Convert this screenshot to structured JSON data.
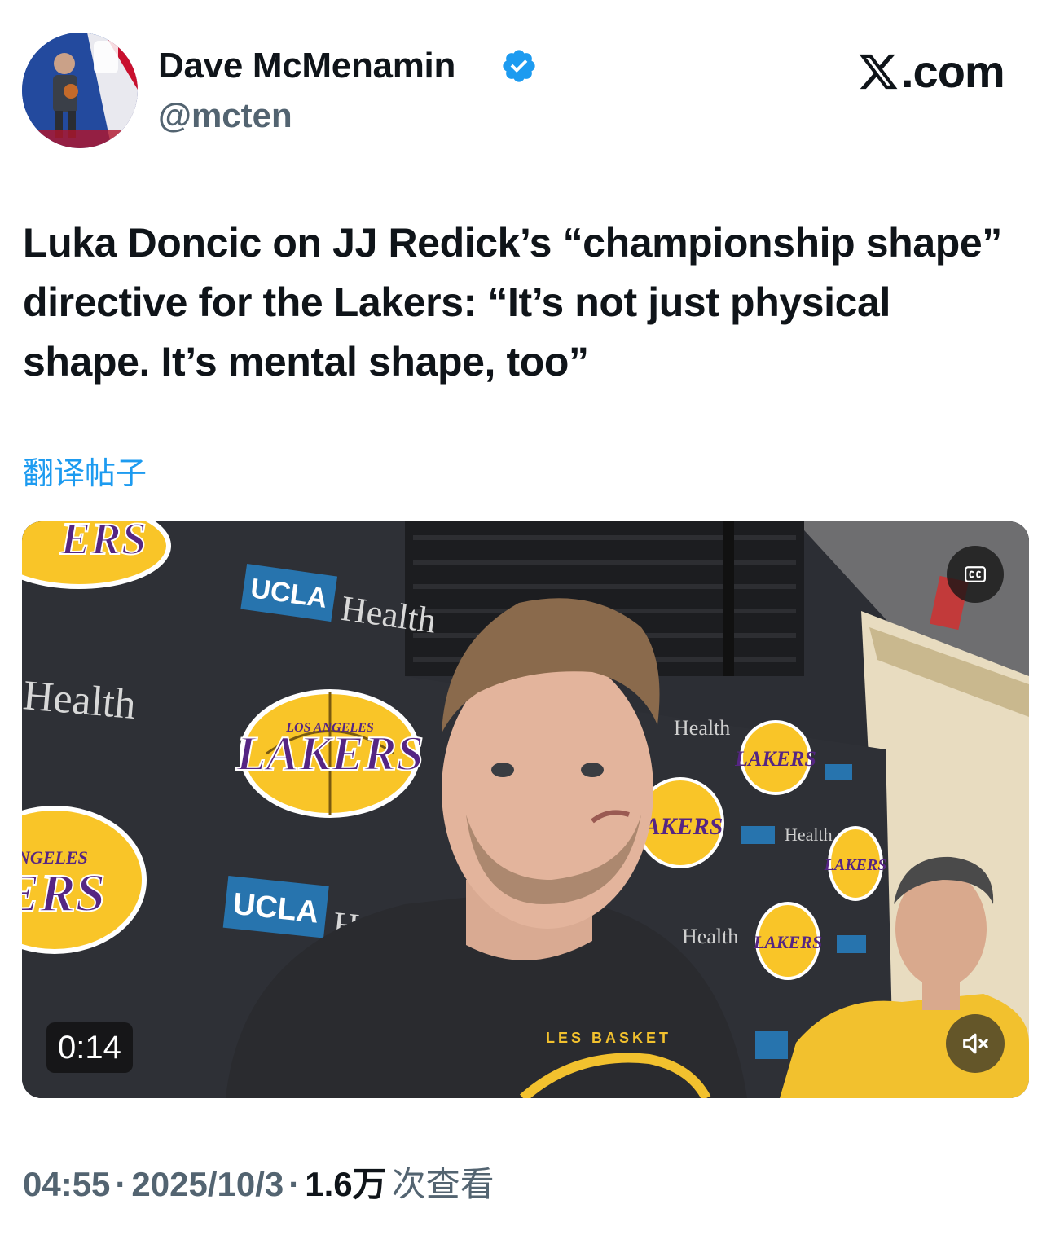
{
  "author": {
    "name": "Dave McMenamin",
    "handle": "@mcten",
    "verified_icon": "verified-badge-icon",
    "badge_color": "#1d9bf0"
  },
  "brand": {
    "text": ".com",
    "icon": "x-logo-icon"
  },
  "tweet": {
    "text": "Luka Doncic on JJ Redick’s “championship shape” directive for the Lakers: “It’s not just physical shape. It’s mental shape, too”",
    "translate_label": "翻译帖子"
  },
  "video": {
    "duration": "0:14",
    "cc_icon": "closed-captions-icon",
    "mute_icon": "muted-speaker-icon",
    "backdrop": {
      "sponsor_ucla": "UCLA",
      "sponsor_health": "Health",
      "team_small": "LOS ANGELES",
      "team_big": "LAKERS",
      "shirt_text": "LOS ANGELES BASKETBALL"
    }
  },
  "meta": {
    "time": "04:55",
    "separator": "·",
    "date": "2025/10/3",
    "views_count": "1.6万",
    "views_label": "次查看"
  },
  "colors": {
    "text_primary": "#0f1419",
    "text_secondary": "#536471",
    "link": "#1d9bf0",
    "lakers_gold": "#f9c528",
    "lakers_purple": "#552583",
    "ucla_blue": "#2774ae"
  }
}
